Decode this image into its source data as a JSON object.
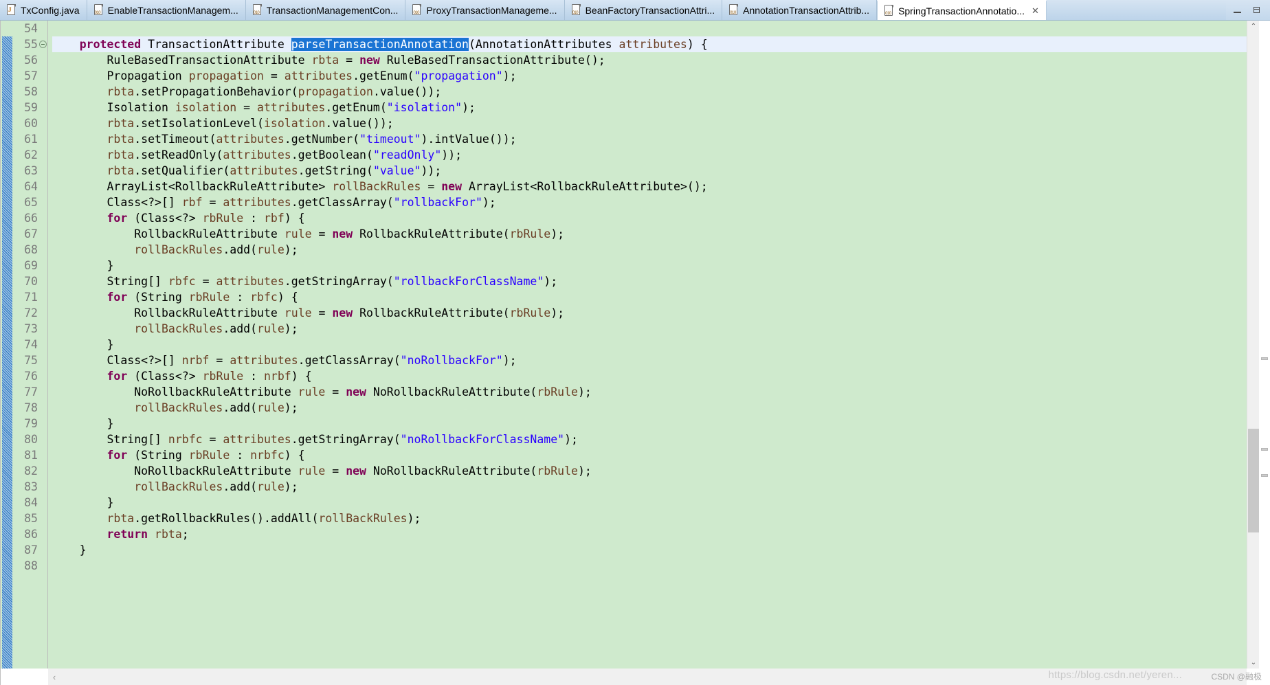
{
  "window": {
    "minimize_label": "Minimize",
    "restore_label": "Restore"
  },
  "tabs": [
    {
      "label": "TxConfig.java",
      "icon": "java-file-icon",
      "active": false,
      "closable": false
    },
    {
      "label": "EnableTransactionManagem...",
      "icon": "class-file-icon",
      "active": false,
      "closable": false
    },
    {
      "label": "TransactionManagementCon...",
      "icon": "class-file-icon",
      "active": false,
      "closable": false
    },
    {
      "label": "ProxyTransactionManageme...",
      "icon": "class-file-icon",
      "active": false,
      "closable": false
    },
    {
      "label": "BeanFactoryTransactionAttri...",
      "icon": "class-file-icon",
      "active": false,
      "closable": false
    },
    {
      "label": "AnnotationTransactionAttrib...",
      "icon": "class-file-icon",
      "active": false,
      "closable": false
    },
    {
      "label": "SpringTransactionAnnotatio...",
      "icon": "class-file-icon",
      "active": true,
      "closable": true,
      "close_label": "✕"
    }
  ],
  "editor": {
    "first_line": 54,
    "current_line": 55,
    "selection_text": "parseTransactionAnnotation",
    "colors": {
      "background": "#cfeacd",
      "current_line": "#e8f0fc",
      "selection": "#1a74d4",
      "keyword": "#7f0055",
      "string": "#2a00ff",
      "local_variable": "#6a3e24",
      "field": "#0000c0",
      "gutter_text": "#7a7a7a"
    },
    "lines": [
      {
        "no": 54,
        "fold": false,
        "tokens": []
      },
      {
        "no": 55,
        "fold": true,
        "tokens": [
          {
            "t": "    ",
            "c": "plain"
          },
          {
            "t": "protected",
            "c": "kw"
          },
          {
            "t": " TransactionAttribute ",
            "c": "plain"
          },
          {
            "t": "parseTransactionAnnotation",
            "c": "sel"
          },
          {
            "t": "(AnnotationAttributes ",
            "c": "plain"
          },
          {
            "t": "attributes",
            "c": "loc"
          },
          {
            "t": ") {",
            "c": "plain"
          }
        ]
      },
      {
        "no": 56,
        "fold": false,
        "tokens": [
          {
            "t": "        RuleBasedTransactionAttribute ",
            "c": "plain"
          },
          {
            "t": "rbta",
            "c": "loc"
          },
          {
            "t": " = ",
            "c": "plain"
          },
          {
            "t": "new",
            "c": "kw"
          },
          {
            "t": " RuleBasedTransactionAttribute();",
            "c": "plain"
          }
        ]
      },
      {
        "no": 57,
        "fold": false,
        "tokens": [
          {
            "t": "        Propagation ",
            "c": "plain"
          },
          {
            "t": "propagation",
            "c": "loc"
          },
          {
            "t": " = ",
            "c": "plain"
          },
          {
            "t": "attributes",
            "c": "loc"
          },
          {
            "t": ".getEnum(",
            "c": "plain"
          },
          {
            "t": "\"propagation\"",
            "c": "str"
          },
          {
            "t": ");",
            "c": "plain"
          }
        ]
      },
      {
        "no": 58,
        "fold": false,
        "tokens": [
          {
            "t": "        ",
            "c": "plain"
          },
          {
            "t": "rbta",
            "c": "loc"
          },
          {
            "t": ".setPropagationBehavior(",
            "c": "plain"
          },
          {
            "t": "propagation",
            "c": "loc"
          },
          {
            "t": ".value());",
            "c": "plain"
          }
        ]
      },
      {
        "no": 59,
        "fold": false,
        "tokens": [
          {
            "t": "        Isolation ",
            "c": "plain"
          },
          {
            "t": "isolation",
            "c": "loc"
          },
          {
            "t": " = ",
            "c": "plain"
          },
          {
            "t": "attributes",
            "c": "loc"
          },
          {
            "t": ".getEnum(",
            "c": "plain"
          },
          {
            "t": "\"isolation\"",
            "c": "str"
          },
          {
            "t": ");",
            "c": "plain"
          }
        ]
      },
      {
        "no": 60,
        "fold": false,
        "tokens": [
          {
            "t": "        ",
            "c": "plain"
          },
          {
            "t": "rbta",
            "c": "loc"
          },
          {
            "t": ".setIsolationLevel(",
            "c": "plain"
          },
          {
            "t": "isolation",
            "c": "loc"
          },
          {
            "t": ".value());",
            "c": "plain"
          }
        ]
      },
      {
        "no": 61,
        "fold": false,
        "tokens": [
          {
            "t": "        ",
            "c": "plain"
          },
          {
            "t": "rbta",
            "c": "loc"
          },
          {
            "t": ".setTimeout(",
            "c": "plain"
          },
          {
            "t": "attributes",
            "c": "loc"
          },
          {
            "t": ".getNumber(",
            "c": "plain"
          },
          {
            "t": "\"timeout\"",
            "c": "str"
          },
          {
            "t": ").intValue());",
            "c": "plain"
          }
        ]
      },
      {
        "no": 62,
        "fold": false,
        "tokens": [
          {
            "t": "        ",
            "c": "plain"
          },
          {
            "t": "rbta",
            "c": "loc"
          },
          {
            "t": ".setReadOnly(",
            "c": "plain"
          },
          {
            "t": "attributes",
            "c": "loc"
          },
          {
            "t": ".getBoolean(",
            "c": "plain"
          },
          {
            "t": "\"readOnly\"",
            "c": "str"
          },
          {
            "t": "));",
            "c": "plain"
          }
        ]
      },
      {
        "no": 63,
        "fold": false,
        "tokens": [
          {
            "t": "        ",
            "c": "plain"
          },
          {
            "t": "rbta",
            "c": "loc"
          },
          {
            "t": ".setQualifier(",
            "c": "plain"
          },
          {
            "t": "attributes",
            "c": "loc"
          },
          {
            "t": ".getString(",
            "c": "plain"
          },
          {
            "t": "\"value\"",
            "c": "str"
          },
          {
            "t": "));",
            "c": "plain"
          }
        ]
      },
      {
        "no": 64,
        "fold": false,
        "tokens": [
          {
            "t": "        ArrayList<RollbackRuleAttribute> ",
            "c": "plain"
          },
          {
            "t": "rollBackRules",
            "c": "loc"
          },
          {
            "t": " = ",
            "c": "plain"
          },
          {
            "t": "new",
            "c": "kw"
          },
          {
            "t": " ArrayList<RollbackRuleAttribute>();",
            "c": "plain"
          }
        ]
      },
      {
        "no": 65,
        "fold": false,
        "tokens": [
          {
            "t": "        Class<?>[] ",
            "c": "plain"
          },
          {
            "t": "rbf",
            "c": "loc"
          },
          {
            "t": " = ",
            "c": "plain"
          },
          {
            "t": "attributes",
            "c": "loc"
          },
          {
            "t": ".getClassArray(",
            "c": "plain"
          },
          {
            "t": "\"rollbackFor\"",
            "c": "str"
          },
          {
            "t": ");",
            "c": "plain"
          }
        ]
      },
      {
        "no": 66,
        "fold": false,
        "tokens": [
          {
            "t": "        ",
            "c": "plain"
          },
          {
            "t": "for",
            "c": "kw"
          },
          {
            "t": " (Class<?> ",
            "c": "plain"
          },
          {
            "t": "rbRule",
            "c": "loc"
          },
          {
            "t": " : ",
            "c": "plain"
          },
          {
            "t": "rbf",
            "c": "loc"
          },
          {
            "t": ") {",
            "c": "plain"
          }
        ]
      },
      {
        "no": 67,
        "fold": false,
        "tokens": [
          {
            "t": "            RollbackRuleAttribute ",
            "c": "plain"
          },
          {
            "t": "rule",
            "c": "loc"
          },
          {
            "t": " = ",
            "c": "plain"
          },
          {
            "t": "new",
            "c": "kw"
          },
          {
            "t": " RollbackRuleAttribute(",
            "c": "plain"
          },
          {
            "t": "rbRule",
            "c": "loc"
          },
          {
            "t": ");",
            "c": "plain"
          }
        ]
      },
      {
        "no": 68,
        "fold": false,
        "tokens": [
          {
            "t": "            ",
            "c": "plain"
          },
          {
            "t": "rollBackRules",
            "c": "loc"
          },
          {
            "t": ".add(",
            "c": "plain"
          },
          {
            "t": "rule",
            "c": "loc"
          },
          {
            "t": ");",
            "c": "plain"
          }
        ]
      },
      {
        "no": 69,
        "fold": false,
        "tokens": [
          {
            "t": "        }",
            "c": "plain"
          }
        ]
      },
      {
        "no": 70,
        "fold": false,
        "tokens": [
          {
            "t": "        String[] ",
            "c": "plain"
          },
          {
            "t": "rbfc",
            "c": "loc"
          },
          {
            "t": " = ",
            "c": "plain"
          },
          {
            "t": "attributes",
            "c": "loc"
          },
          {
            "t": ".getStringArray(",
            "c": "plain"
          },
          {
            "t": "\"rollbackForClassName\"",
            "c": "str"
          },
          {
            "t": ");",
            "c": "plain"
          }
        ]
      },
      {
        "no": 71,
        "fold": false,
        "tokens": [
          {
            "t": "        ",
            "c": "plain"
          },
          {
            "t": "for",
            "c": "kw"
          },
          {
            "t": " (String ",
            "c": "plain"
          },
          {
            "t": "rbRule",
            "c": "loc"
          },
          {
            "t": " : ",
            "c": "plain"
          },
          {
            "t": "rbfc",
            "c": "loc"
          },
          {
            "t": ") {",
            "c": "plain"
          }
        ]
      },
      {
        "no": 72,
        "fold": false,
        "tokens": [
          {
            "t": "            RollbackRuleAttribute ",
            "c": "plain"
          },
          {
            "t": "rule",
            "c": "loc"
          },
          {
            "t": " = ",
            "c": "plain"
          },
          {
            "t": "new",
            "c": "kw"
          },
          {
            "t": " RollbackRuleAttribute(",
            "c": "plain"
          },
          {
            "t": "rbRule",
            "c": "loc"
          },
          {
            "t": ");",
            "c": "plain"
          }
        ]
      },
      {
        "no": 73,
        "fold": false,
        "tokens": [
          {
            "t": "            ",
            "c": "plain"
          },
          {
            "t": "rollBackRules",
            "c": "loc"
          },
          {
            "t": ".add(",
            "c": "plain"
          },
          {
            "t": "rule",
            "c": "loc"
          },
          {
            "t": ");",
            "c": "plain"
          }
        ]
      },
      {
        "no": 74,
        "fold": false,
        "tokens": [
          {
            "t": "        }",
            "c": "plain"
          }
        ]
      },
      {
        "no": 75,
        "fold": false,
        "tokens": [
          {
            "t": "        Class<?>[] ",
            "c": "plain"
          },
          {
            "t": "nrbf",
            "c": "loc"
          },
          {
            "t": " = ",
            "c": "plain"
          },
          {
            "t": "attributes",
            "c": "loc"
          },
          {
            "t": ".getClassArray(",
            "c": "plain"
          },
          {
            "t": "\"noRollbackFor\"",
            "c": "str"
          },
          {
            "t": ");",
            "c": "plain"
          }
        ]
      },
      {
        "no": 76,
        "fold": false,
        "tokens": [
          {
            "t": "        ",
            "c": "plain"
          },
          {
            "t": "for",
            "c": "kw"
          },
          {
            "t": " (Class<?> ",
            "c": "plain"
          },
          {
            "t": "rbRule",
            "c": "loc"
          },
          {
            "t": " : ",
            "c": "plain"
          },
          {
            "t": "nrbf",
            "c": "loc"
          },
          {
            "t": ") {",
            "c": "plain"
          }
        ]
      },
      {
        "no": 77,
        "fold": false,
        "tokens": [
          {
            "t": "            NoRollbackRuleAttribute ",
            "c": "plain"
          },
          {
            "t": "rule",
            "c": "loc"
          },
          {
            "t": " = ",
            "c": "plain"
          },
          {
            "t": "new",
            "c": "kw"
          },
          {
            "t": " NoRollbackRuleAttribute(",
            "c": "plain"
          },
          {
            "t": "rbRule",
            "c": "loc"
          },
          {
            "t": ");",
            "c": "plain"
          }
        ]
      },
      {
        "no": 78,
        "fold": false,
        "tokens": [
          {
            "t": "            ",
            "c": "plain"
          },
          {
            "t": "rollBackRules",
            "c": "loc"
          },
          {
            "t": ".add(",
            "c": "plain"
          },
          {
            "t": "rule",
            "c": "loc"
          },
          {
            "t": ");",
            "c": "plain"
          }
        ]
      },
      {
        "no": 79,
        "fold": false,
        "tokens": [
          {
            "t": "        }",
            "c": "plain"
          }
        ]
      },
      {
        "no": 80,
        "fold": false,
        "tokens": [
          {
            "t": "        String[] ",
            "c": "plain"
          },
          {
            "t": "nrbfc",
            "c": "loc"
          },
          {
            "t": " = ",
            "c": "plain"
          },
          {
            "t": "attributes",
            "c": "loc"
          },
          {
            "t": ".getStringArray(",
            "c": "plain"
          },
          {
            "t": "\"noRollbackForClassName\"",
            "c": "str"
          },
          {
            "t": ");",
            "c": "plain"
          }
        ]
      },
      {
        "no": 81,
        "fold": false,
        "tokens": [
          {
            "t": "        ",
            "c": "plain"
          },
          {
            "t": "for",
            "c": "kw"
          },
          {
            "t": " (String ",
            "c": "plain"
          },
          {
            "t": "rbRule",
            "c": "loc"
          },
          {
            "t": " : ",
            "c": "plain"
          },
          {
            "t": "nrbfc",
            "c": "loc"
          },
          {
            "t": ") {",
            "c": "plain"
          }
        ]
      },
      {
        "no": 82,
        "fold": false,
        "tokens": [
          {
            "t": "            NoRollbackRuleAttribute ",
            "c": "plain"
          },
          {
            "t": "rule",
            "c": "loc"
          },
          {
            "t": " = ",
            "c": "plain"
          },
          {
            "t": "new",
            "c": "kw"
          },
          {
            "t": " NoRollbackRuleAttribute(",
            "c": "plain"
          },
          {
            "t": "rbRule",
            "c": "loc"
          },
          {
            "t": ");",
            "c": "plain"
          }
        ]
      },
      {
        "no": 83,
        "fold": false,
        "tokens": [
          {
            "t": "            ",
            "c": "plain"
          },
          {
            "t": "rollBackRules",
            "c": "loc"
          },
          {
            "t": ".add(",
            "c": "plain"
          },
          {
            "t": "rule",
            "c": "loc"
          },
          {
            "t": ");",
            "c": "plain"
          }
        ]
      },
      {
        "no": 84,
        "fold": false,
        "tokens": [
          {
            "t": "        }",
            "c": "plain"
          }
        ]
      },
      {
        "no": 85,
        "fold": false,
        "tokens": [
          {
            "t": "        ",
            "c": "plain"
          },
          {
            "t": "rbta",
            "c": "loc"
          },
          {
            "t": ".getRollbackRules().addAll(",
            "c": "plain"
          },
          {
            "t": "rollBackRules",
            "c": "loc"
          },
          {
            "t": ");",
            "c": "plain"
          }
        ]
      },
      {
        "no": 86,
        "fold": false,
        "tokens": [
          {
            "t": "        ",
            "c": "plain"
          },
          {
            "t": "return",
            "c": "kw"
          },
          {
            "t": " ",
            "c": "plain"
          },
          {
            "t": "rbta",
            "c": "loc"
          },
          {
            "t": ";",
            "c": "plain"
          }
        ]
      },
      {
        "no": 87,
        "fold": false,
        "tokens": [
          {
            "t": "    }",
            "c": "plain"
          }
        ]
      },
      {
        "no": 88,
        "fold": false,
        "tokens": []
      }
    ]
  },
  "scrollbars": {
    "vertical": {
      "up_arrow": "⌃",
      "down_arrow": "⌄",
      "thumb_top_pct": 63,
      "thumb_height_pct": 16
    },
    "horizontal": {
      "left_arrow": "‹"
    },
    "overview_marks_pct": [
      52,
      66,
      70
    ]
  },
  "watermark": {
    "url": "https://blog.csdn.net/yeren...",
    "badge": "CSDN @融极"
  }
}
